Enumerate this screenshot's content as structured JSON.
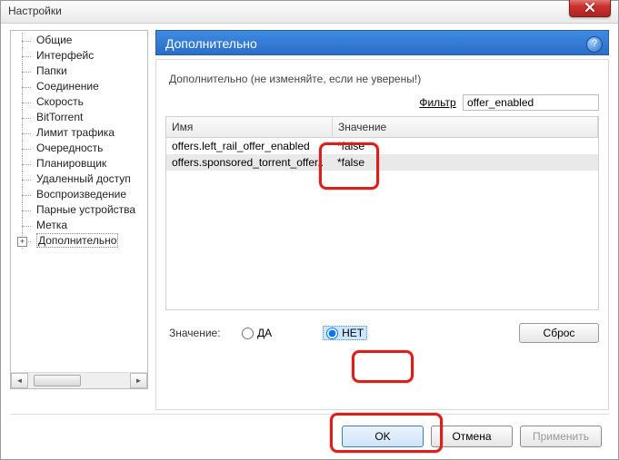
{
  "window": {
    "title": "Настройки"
  },
  "sidebar": {
    "items": [
      {
        "label": "Общие"
      },
      {
        "label": "Интерфейс"
      },
      {
        "label": "Папки"
      },
      {
        "label": "Соединение"
      },
      {
        "label": "Скорость"
      },
      {
        "label": "BitTorrent"
      },
      {
        "label": "Лимит трафика"
      },
      {
        "label": "Очередность"
      },
      {
        "label": "Планировщик"
      },
      {
        "label": "Удаленный доступ"
      },
      {
        "label": "Воспроизведение"
      },
      {
        "label": "Парные устройства"
      },
      {
        "label": "Метка"
      },
      {
        "label": "Дополнительно"
      }
    ],
    "selected_index": 13,
    "expander_on_index": 13
  },
  "panel": {
    "title": "Дополнительно",
    "hint": "Дополнительно (не изменяйте, если не уверены!)",
    "filter_label": "Фильтр",
    "filter_value": "offer_enabled",
    "columns": {
      "name": "Имя",
      "value": "Значение"
    },
    "rows": [
      {
        "name": "offers.left_rail_offer_enabled",
        "value": "*false"
      },
      {
        "name": "offers.sponsored_torrent_offer..",
        "value": "*false"
      }
    ],
    "value_editor": {
      "label": "Значение:",
      "yes": "ДА",
      "no": "НЕТ",
      "selected": "no",
      "reset": "Сброс"
    }
  },
  "buttons": {
    "ok": "OK",
    "cancel": "Отмена",
    "apply": "Применить"
  }
}
